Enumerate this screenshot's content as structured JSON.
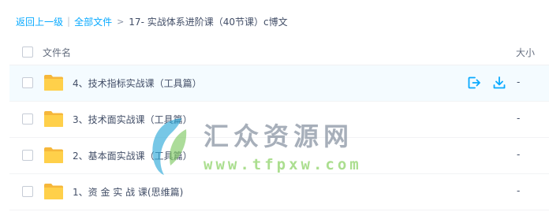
{
  "breadcrumb": {
    "back": "返回上一级",
    "separator": "|",
    "all_files": "全部文件",
    "arrow": ">",
    "current": "17- 实战体系进阶课（40节课）c博文"
  },
  "header": {
    "name_label": "文件名",
    "size_label": "大小"
  },
  "rows": [
    {
      "name": "4、技术指标实战课（工具篇）",
      "size": "-",
      "icon": "folder-icon",
      "hovered": true
    },
    {
      "name": "3、技术面实战课（工具篇）",
      "size": "-",
      "icon": "folder-icon",
      "hovered": false
    },
    {
      "name": "2、基本面实战课（工具篇）",
      "size": "-",
      "icon": "folder-icon",
      "hovered": false
    },
    {
      "name": "1、资 金 实 战 课(思维篇)",
      "size": "-",
      "icon": "folder-icon",
      "hovered": false
    }
  ],
  "row_actions": [
    {
      "icon": "share-icon"
    },
    {
      "icon": "download-icon"
    }
  ],
  "watermark": {
    "main": "汇众资源网",
    "sub": "www.tfpxw.com"
  },
  "colors": {
    "accent": "#09aaff",
    "folder": "#ffd04a",
    "hover_row": "#f4fbff",
    "text": "#424e67"
  }
}
